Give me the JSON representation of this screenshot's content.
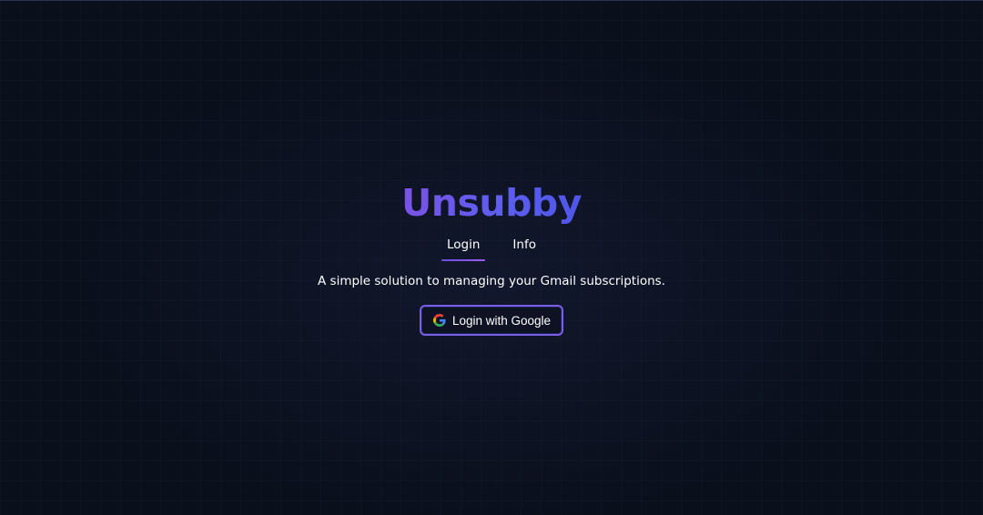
{
  "app": {
    "logo_text": "Unsubby"
  },
  "tabs": [
    {
      "label": "Login",
      "active": true
    },
    {
      "label": "Info",
      "active": false
    }
  ],
  "main": {
    "tagline": "A simple solution to managing your Gmail subscriptions.",
    "login_button_label": "Login with Google",
    "login_button_icon": "google-icon"
  },
  "colors": {
    "background": "#0a0f1c",
    "accent_purple": "#7a52e6",
    "accent_blue": "#4f56e8",
    "text": "#ffffff"
  }
}
